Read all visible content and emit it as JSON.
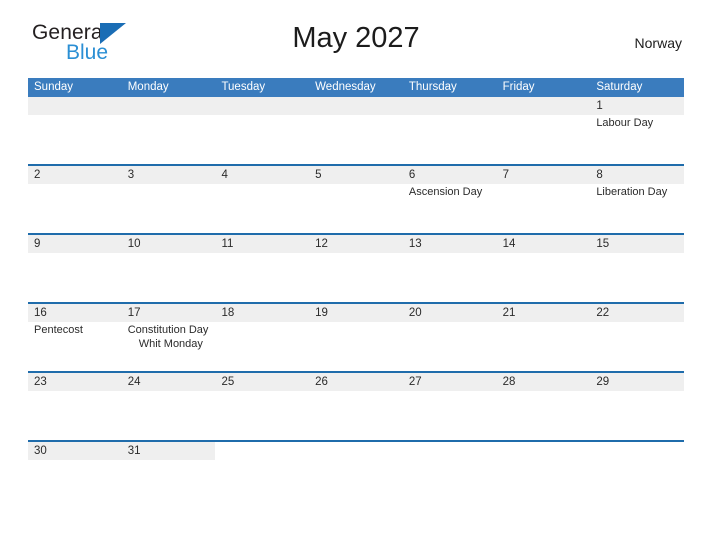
{
  "brand": {
    "name_part1": "General",
    "name_part2": "Blue",
    "triangle_icon": "triangle-icon",
    "color_dark": "#231f20",
    "color_blue": "#2b8fd4",
    "color_triangle": "#1a6db5"
  },
  "header": {
    "title": "May 2027",
    "region": "Norway"
  },
  "colors": {
    "header_blue": "#3a7cbe",
    "divider_blue": "#1f6cab",
    "band_gray": "#efefef",
    "text": "#2b2b2b"
  },
  "calendar": {
    "day_names": [
      "Sunday",
      "Monday",
      "Tuesday",
      "Wednesday",
      "Thursday",
      "Friday",
      "Saturday"
    ],
    "weeks": [
      {
        "band_columns": 7,
        "days": [
          {
            "num": "",
            "events": []
          },
          {
            "num": "",
            "events": []
          },
          {
            "num": "",
            "events": []
          },
          {
            "num": "",
            "events": []
          },
          {
            "num": "",
            "events": []
          },
          {
            "num": "",
            "events": []
          },
          {
            "num": "1",
            "events": [
              "Labour Day"
            ]
          }
        ]
      },
      {
        "band_columns": 7,
        "days": [
          {
            "num": "2",
            "events": []
          },
          {
            "num": "3",
            "events": []
          },
          {
            "num": "4",
            "events": []
          },
          {
            "num": "5",
            "events": []
          },
          {
            "num": "6",
            "events": [
              "Ascension Day"
            ]
          },
          {
            "num": "7",
            "events": []
          },
          {
            "num": "8",
            "events": [
              "Liberation Day"
            ]
          }
        ]
      },
      {
        "band_columns": 7,
        "days": [
          {
            "num": "9",
            "events": []
          },
          {
            "num": "10",
            "events": []
          },
          {
            "num": "11",
            "events": []
          },
          {
            "num": "12",
            "events": []
          },
          {
            "num": "13",
            "events": []
          },
          {
            "num": "14",
            "events": []
          },
          {
            "num": "15",
            "events": []
          }
        ]
      },
      {
        "band_columns": 7,
        "days": [
          {
            "num": "16",
            "events": [
              "Pentecost"
            ]
          },
          {
            "num": "17",
            "events": [
              "Constitution Day",
              "Whit Monday"
            ]
          },
          {
            "num": "18",
            "events": []
          },
          {
            "num": "19",
            "events": []
          },
          {
            "num": "20",
            "events": []
          },
          {
            "num": "21",
            "events": []
          },
          {
            "num": "22",
            "events": []
          }
        ]
      },
      {
        "band_columns": 7,
        "days": [
          {
            "num": "23",
            "events": []
          },
          {
            "num": "24",
            "events": []
          },
          {
            "num": "25",
            "events": []
          },
          {
            "num": "26",
            "events": []
          },
          {
            "num": "27",
            "events": []
          },
          {
            "num": "28",
            "events": []
          },
          {
            "num": "29",
            "events": []
          }
        ]
      },
      {
        "band_columns": 2,
        "days": [
          {
            "num": "30",
            "events": []
          },
          {
            "num": "31",
            "events": []
          },
          {
            "num": "",
            "events": []
          },
          {
            "num": "",
            "events": []
          },
          {
            "num": "",
            "events": []
          },
          {
            "num": "",
            "events": []
          },
          {
            "num": "",
            "events": []
          }
        ]
      }
    ]
  }
}
